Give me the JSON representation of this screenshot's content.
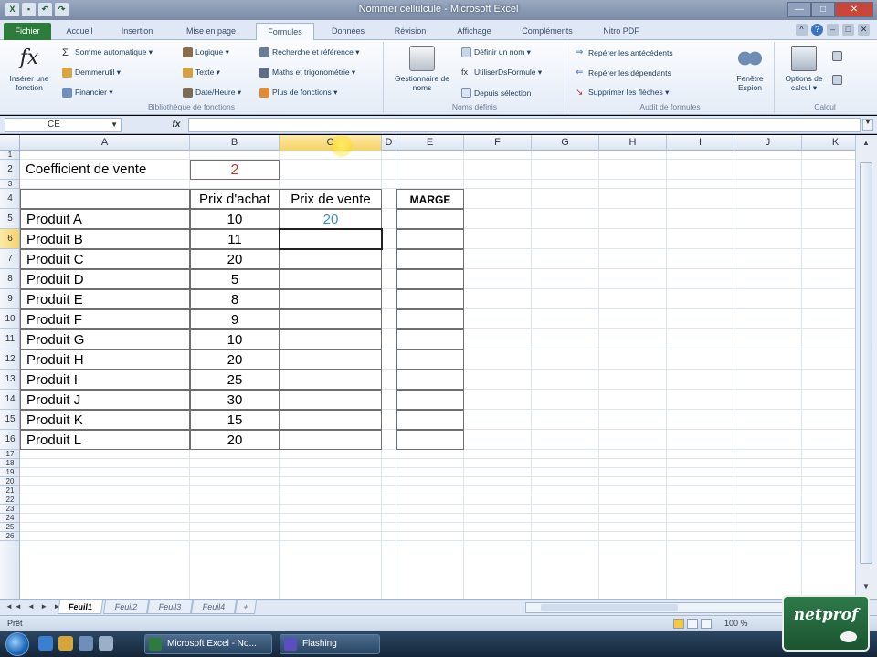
{
  "window": {
    "title": "Nommer cellulcule - Microsoft Excel",
    "close": "✕",
    "min": "—",
    "max": "□"
  },
  "ribbon_tabs": [
    "Fichier",
    "Accueil",
    "Insertion",
    "Mise en page",
    "Formules",
    "Données",
    "Révision",
    "Affichage",
    "Compléments",
    "Nitro PDF"
  ],
  "ribbon": {
    "insert_function": "Insérer une fonction",
    "library": {
      "col1": [
        "Somme automatique ▾",
        "Demmerutil ▾",
        "Financier ▾"
      ],
      "col2": [
        "Logique ▾",
        "Texte ▾",
        "Date/Heure ▾"
      ],
      "col3": [
        "Recherche et référence ▾",
        "Maths et trigonométrie ▾",
        "Plus de fonctions ▾"
      ],
      "label": "Bibliothèque de fonctions"
    },
    "names": {
      "manager": "Gestionnaire de noms",
      "items": [
        "Définir un nom ▾",
        "UtiliserDsFormule ▾",
        "Depuis sélection"
      ],
      "label": "Noms définis"
    },
    "audit": {
      "items": [
        "Repérer les antécédents",
        "Repérer les dépendants",
        "Supprimer les flèches ▾"
      ],
      "window": "Fenêtre Espion",
      "label": "Audit de formules"
    },
    "calc": {
      "options": "Options de calcul ▾",
      "label": "Calcul"
    }
  },
  "formula_bar": {
    "name_box": "CE",
    "fx": "fx"
  },
  "columns": [
    "A",
    "B",
    "C",
    "D",
    "E",
    "F",
    "G",
    "H",
    "I",
    "J",
    "K"
  ],
  "selected_column": "C",
  "rows": [
    "1",
    "2",
    "3",
    "4",
    "5",
    "6",
    "7",
    "8",
    "9",
    "10",
    "11",
    "12",
    "13",
    "14",
    "15",
    "16",
    "17",
    "18",
    "19",
    "20",
    "21",
    "22",
    "23",
    "24",
    "25",
    "26"
  ],
  "selected_row": "6",
  "sheet": {
    "coef_label": "Coefficient de vente",
    "coef_value": "2",
    "headers": {
      "achat": "Prix d'achat",
      "vente": "Prix de vente",
      "marge": "MARGE"
    },
    "products": [
      {
        "name": "Produit A",
        "achat": "10",
        "vente": "20"
      },
      {
        "name": "Produit B",
        "achat": "11",
        "vente": ""
      },
      {
        "name": "Produit C",
        "achat": "20",
        "vente": ""
      },
      {
        "name": "Produit D",
        "achat": "5",
        "vente": ""
      },
      {
        "name": "Produit E",
        "achat": "8",
        "vente": ""
      },
      {
        "name": "Produit F",
        "achat": "9",
        "vente": ""
      },
      {
        "name": "Produit G",
        "achat": "10",
        "vente": ""
      },
      {
        "name": "Produit H",
        "achat": "20",
        "vente": ""
      },
      {
        "name": "Produit I",
        "achat": "25",
        "vente": ""
      },
      {
        "name": "Produit J",
        "achat": "30",
        "vente": ""
      },
      {
        "name": "Produit K",
        "achat": "15",
        "vente": ""
      },
      {
        "name": "Produit L",
        "achat": "20",
        "vente": ""
      }
    ]
  },
  "sheet_tabs": [
    "Feuil1",
    "Feuil2",
    "Feuil3",
    "Feuil4"
  ],
  "active_sheet": "Feuil1",
  "status": {
    "state": "Prêt",
    "zoom": "100 %"
  },
  "taskbar": {
    "tasks": [
      "Microsoft Excel - No...",
      "Flashing"
    ]
  },
  "brand": "netprof",
  "colors": {
    "excel_green": "#2c7d3c",
    "coef_red": "#c0392b",
    "value_blue": "#3a8fd0",
    "selection_orange": "#f7d262"
  }
}
